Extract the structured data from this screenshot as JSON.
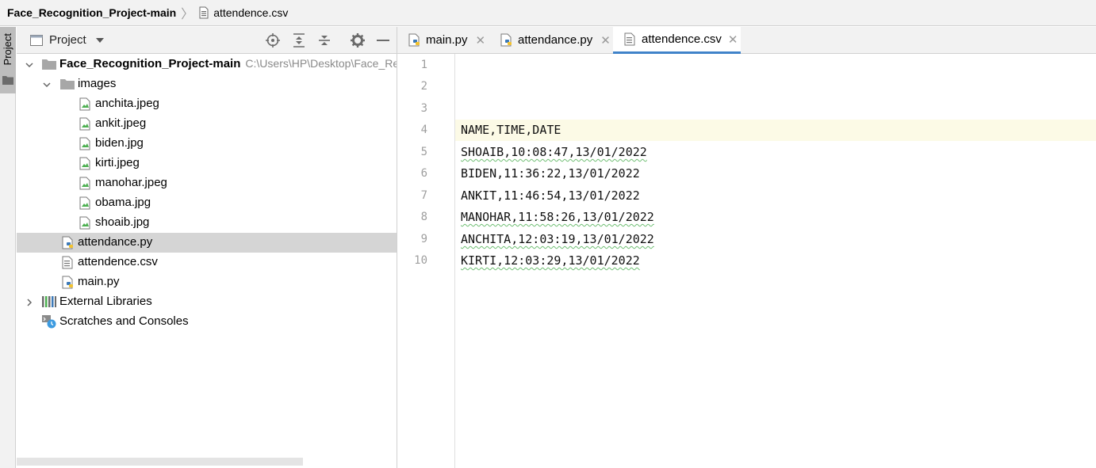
{
  "breadcrumb": {
    "project": "Face_Recognition_Project-main",
    "file": "attendence.csv"
  },
  "sidebar_stripe": {
    "label": "Project"
  },
  "project_panel": {
    "title": "Project",
    "root": {
      "name": "Face_Recognition_Project-main",
      "path": "C:\\Users\\HP\\Desktop\\Face_Rec"
    },
    "images_folder": "images",
    "images": [
      "anchita.jpeg",
      "ankit.jpeg",
      "biden.jpg",
      "kirti.jpeg",
      "manohar.jpeg",
      "obama.jpg",
      "shoaib.jpg"
    ],
    "files": [
      "attendance.py",
      "attendence.csv",
      "main.py"
    ],
    "selected_file": "attendance.py",
    "external_libraries": "External Libraries",
    "scratches": "Scratches and Consoles"
  },
  "editor_tabs": [
    {
      "label": "main.py",
      "active": false
    },
    {
      "label": "attendance.py",
      "active": false
    },
    {
      "label": "attendence.csv",
      "active": true
    }
  ],
  "editor": {
    "line_numbers": [
      "1",
      "2",
      "3",
      "4",
      "5",
      "6",
      "7",
      "8",
      "9",
      "10"
    ],
    "lines": [
      "",
      "",
      "",
      "NAME,TIME,DATE",
      "SHOAIB,10:08:47,13/01/2022",
      "BIDEN,11:36:22,13/01/2022",
      "ANKIT,11:46:54,13/01/2022",
      "MANOHAR,11:58:26,13/01/2022",
      "ANCHITA,12:03:19,13/01/2022",
      "KIRTI,12:03:29,13/01/2022"
    ],
    "current_line": "4"
  },
  "colors": {
    "accent": "#4083c9",
    "selection": "#d5d5d5",
    "current_line": "#fcfae6"
  }
}
